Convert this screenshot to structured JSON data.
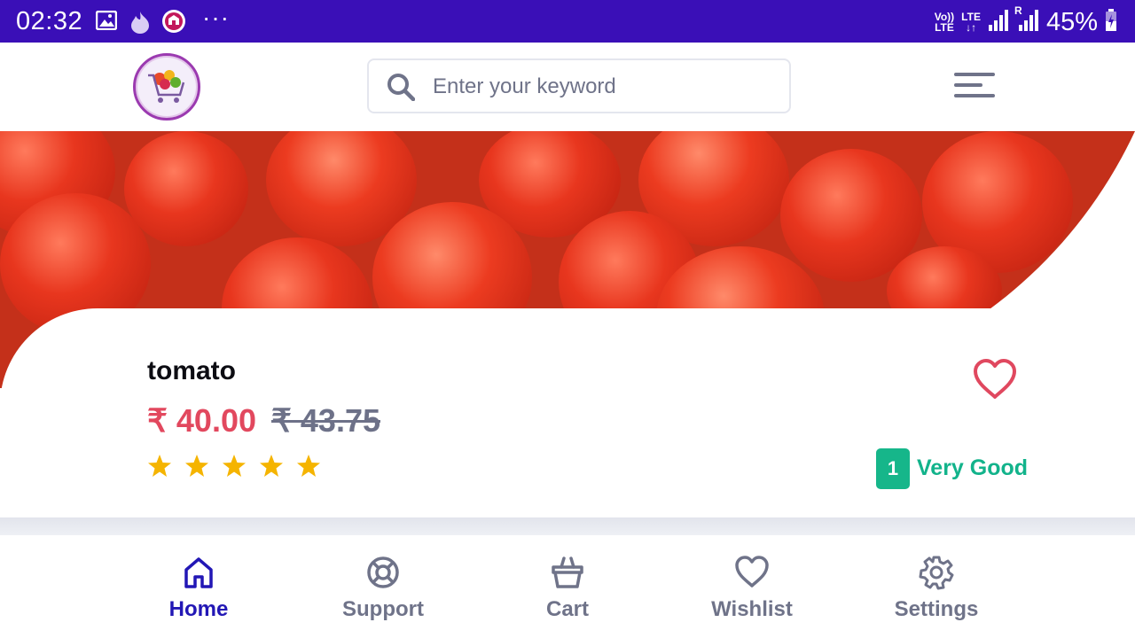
{
  "status_bar": {
    "time": "02:32",
    "icons_left": [
      "image-icon",
      "fire-icon",
      "app-icon"
    ],
    "more": "···",
    "volte": "Vo))",
    "lte1": "LTE",
    "lte2": "LTE",
    "roaming": "R",
    "battery": "45%"
  },
  "header": {
    "logo": "shopping-cart-logo",
    "search": {
      "placeholder": "Enter your keyword",
      "value": ""
    },
    "menu_icon": "hamburger-menu-icon"
  },
  "product": {
    "name": "tomato",
    "price": "₹ 40.00",
    "old_price": "₹ 43.75",
    "rating_stars": 5,
    "rating_count": "1",
    "rating_text": "Very Good",
    "wishlist_icon": "heart-icon"
  },
  "colors": {
    "status_bar": "#3a0fb7",
    "price": "#e2485e",
    "rating": "#16b68a",
    "star": "#f5b400",
    "active_nav": "#2217b5",
    "inactive": "#6f7389"
  },
  "bottom_nav": {
    "items": [
      {
        "label": "Home",
        "icon": "home-icon",
        "active": true
      },
      {
        "label": "Support",
        "icon": "lifebuoy-icon",
        "active": false
      },
      {
        "label": "Cart",
        "icon": "basket-icon",
        "active": false
      },
      {
        "label": "Wishlist",
        "icon": "heart-icon",
        "active": false
      },
      {
        "label": "Settings",
        "icon": "gear-icon",
        "active": false
      }
    ]
  }
}
